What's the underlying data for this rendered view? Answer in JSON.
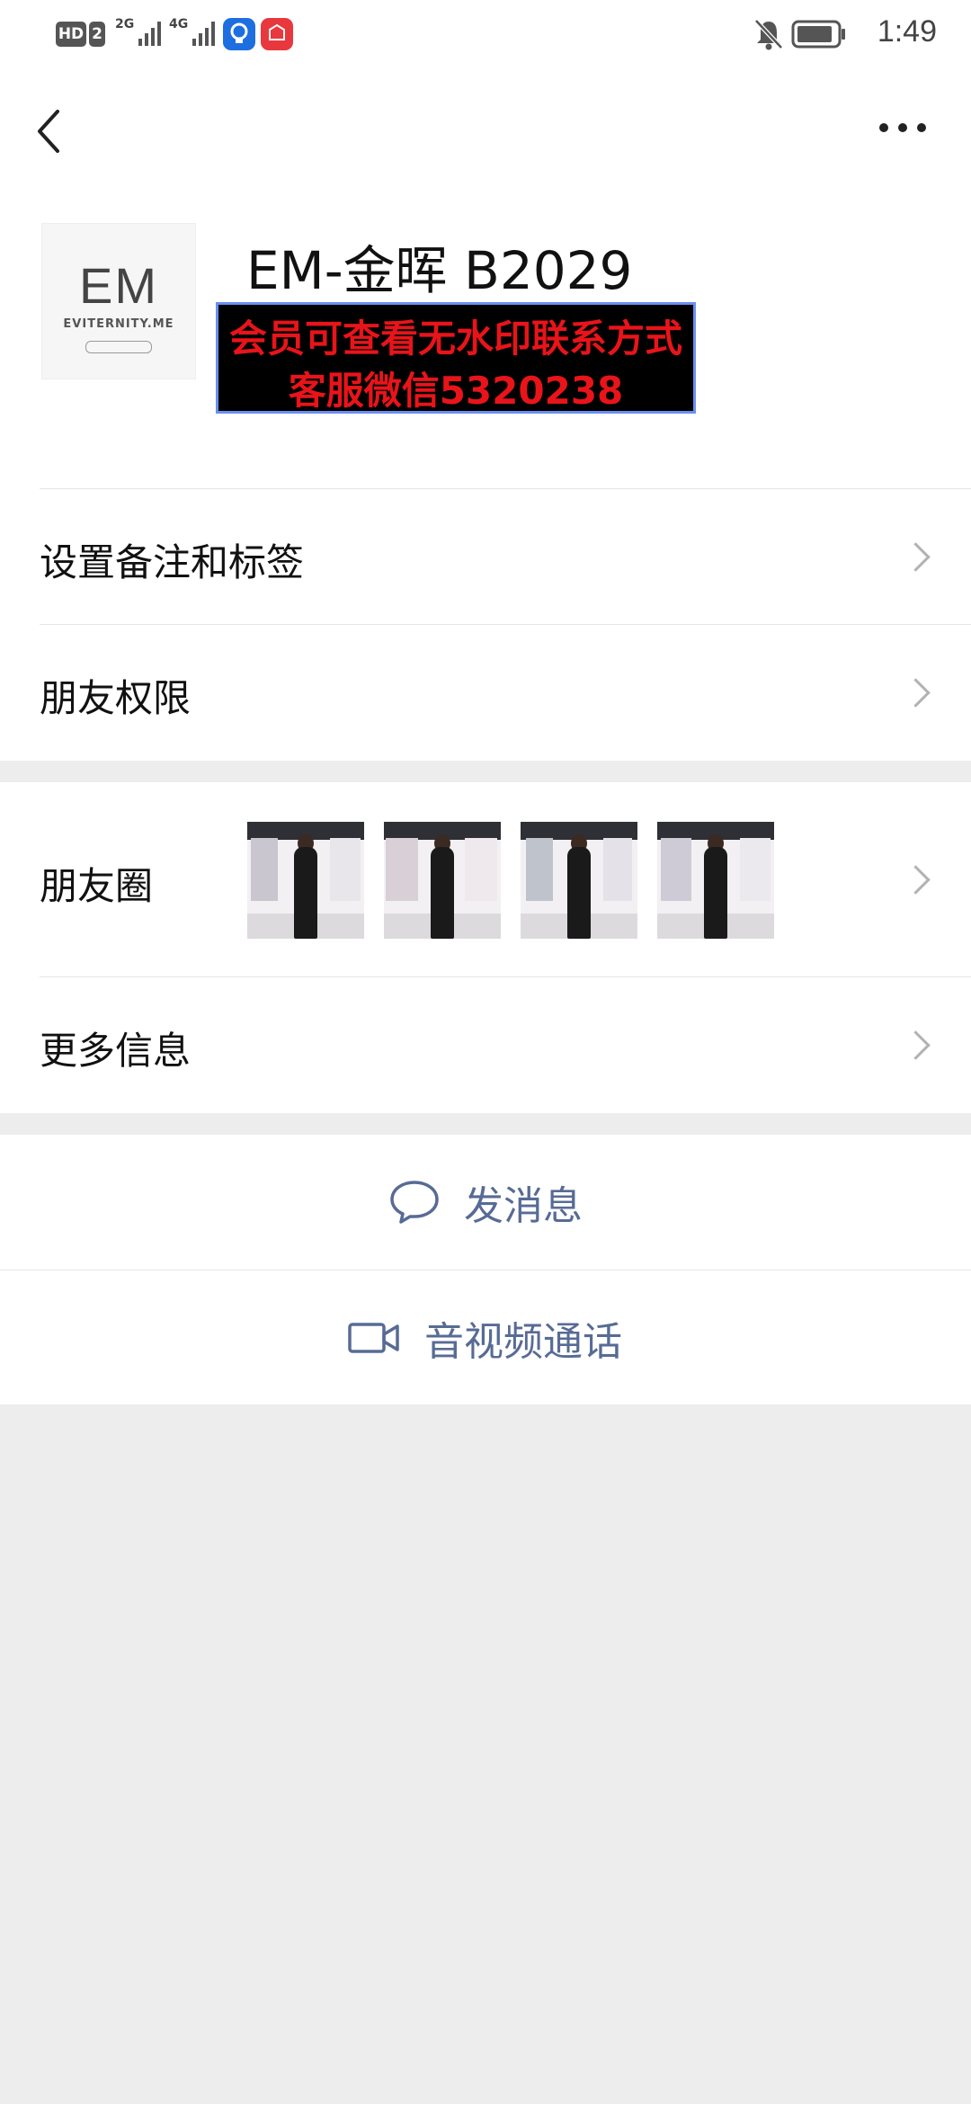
{
  "status_bar": {
    "hd_label": "HD",
    "sim_label": "2",
    "signal1_label": "2G",
    "signal2_label": "4G",
    "time": "1:49"
  },
  "header": {
    "back_icon": "chevron-left-icon",
    "more_icon": "more-dots-icon"
  },
  "profile": {
    "avatar_logo": "EM",
    "avatar_brand": "EVITERNITY.ME",
    "nickname": "EM-金晖 B2029",
    "watermark_line1": "会员可查看无水印联系方式",
    "watermark_line2": "客服微信5320238"
  },
  "settings": {
    "items": [
      {
        "label": "设置备注和标签"
      },
      {
        "label": "朋友权限"
      }
    ]
  },
  "moments": {
    "label": "朋友圈",
    "more_label": "更多信息"
  },
  "actions": {
    "message_label": "发消息",
    "call_label": "音视频通话"
  },
  "colors": {
    "link_blue": "#576b95",
    "background": "#ededed",
    "watermark_red": "#e8141a"
  }
}
